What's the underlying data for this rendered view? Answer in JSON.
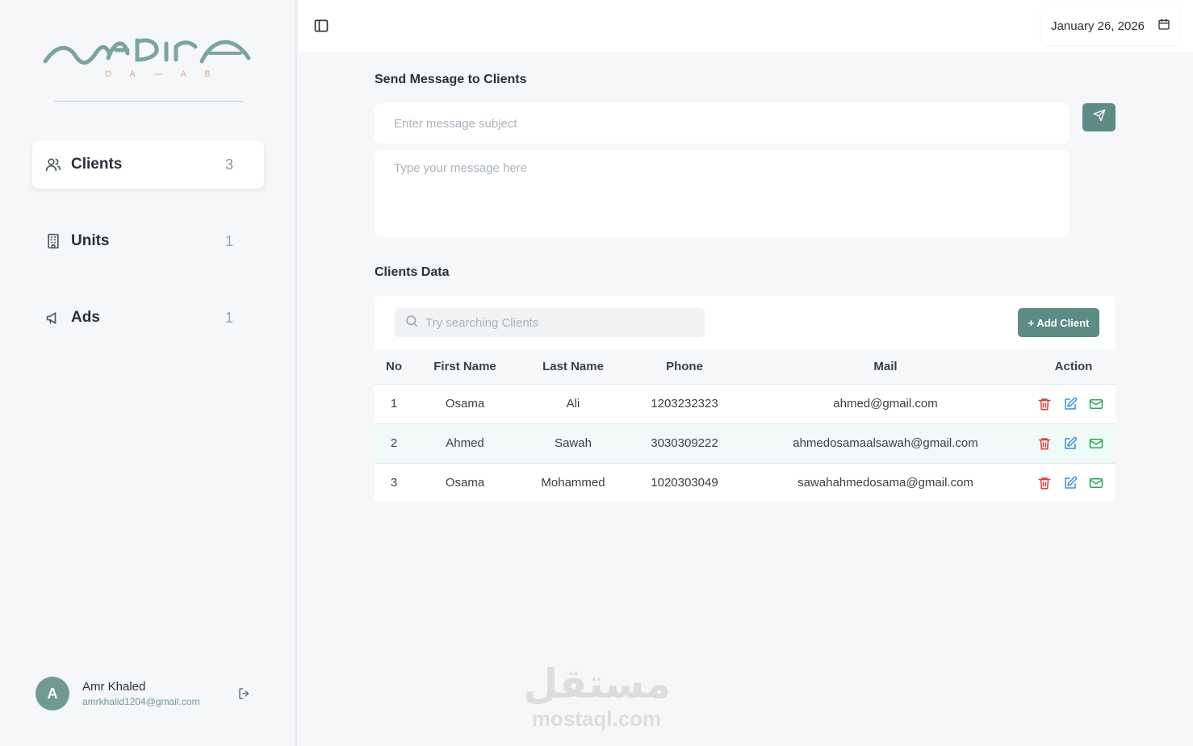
{
  "brand": {
    "name": "NADIRA",
    "subtitle": "D A — A B",
    "primary_color": "#6f9a92",
    "accent_color": "#5d8c84"
  },
  "sidebar": {
    "items": [
      {
        "label": "Clients",
        "count": "3",
        "icon": "users-icon",
        "active": true
      },
      {
        "label": "Units",
        "count": "1",
        "icon": "building-icon",
        "active": false
      },
      {
        "label": "Ads",
        "count": "1",
        "icon": "megaphone-icon",
        "active": false
      }
    ],
    "user": {
      "initial": "A",
      "name": "Amr Khaled",
      "email": "amrkhalid1204@gmail.com"
    }
  },
  "topbar": {
    "date": "January 26, 2026"
  },
  "message": {
    "title": "Send Message to Clients",
    "subject_placeholder": "Enter message subject",
    "body_placeholder": "Type your message here"
  },
  "clients": {
    "title": "Clients Data",
    "search_placeholder": "Try searching Clients",
    "add_label": "+ Add Client",
    "columns": [
      "No",
      "First Name",
      "Last Name",
      "Phone",
      "Mail",
      "Action"
    ],
    "rows": [
      {
        "no": "1",
        "first": "Osama",
        "last": "Ali",
        "phone": "1203232323",
        "mail": "ahmed@gmail.com"
      },
      {
        "no": "2",
        "first": "Ahmed",
        "last": "Sawah",
        "phone": "3030309222",
        "mail": "ahmedosamaalsawah@gmail.com"
      },
      {
        "no": "3",
        "first": "Osama",
        "last": "Mohammed",
        "phone": "1020303049",
        "mail": "sawahahmedosama@gmail.com"
      }
    ]
  },
  "watermark": {
    "arabic": "مستقل",
    "latin": "mostaql.com"
  }
}
